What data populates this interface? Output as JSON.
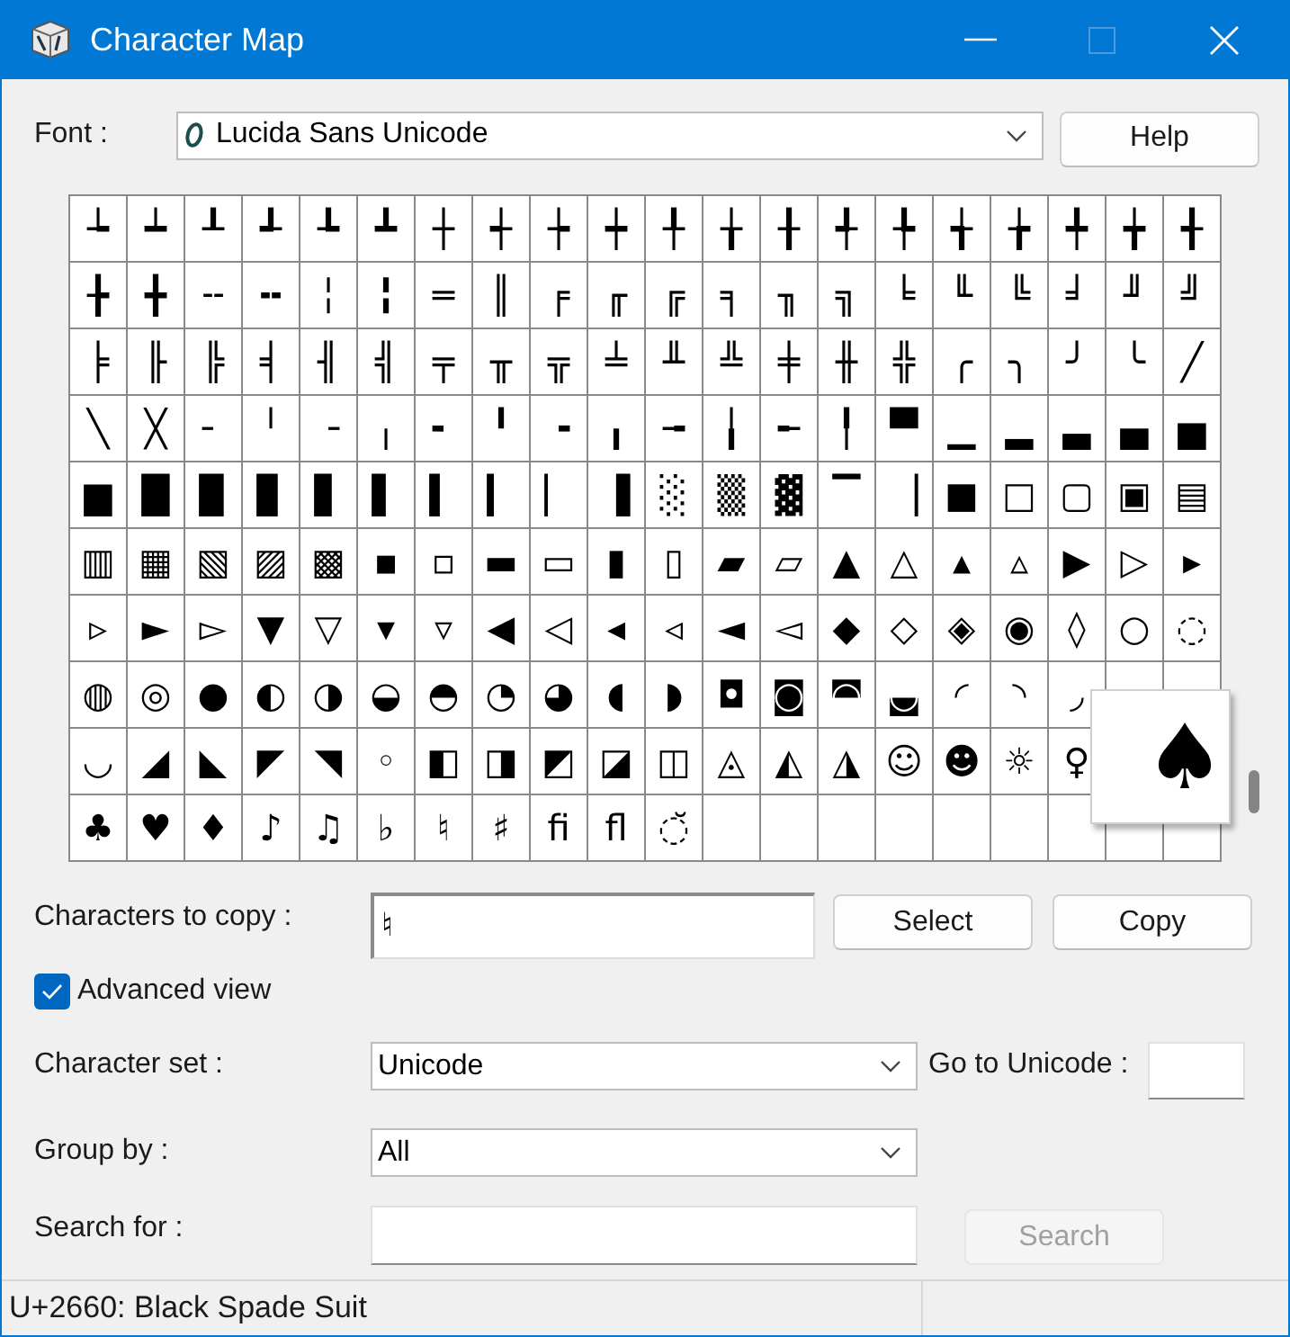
{
  "window": {
    "title": "Character Map"
  },
  "font": {
    "label": "Font :",
    "value": "Lucida Sans Unicode"
  },
  "help_button": {
    "label": "Help"
  },
  "grid": {
    "rows": [
      [
        "┶",
        "┷",
        "┸",
        "┹",
        "┺",
        "┻",
        "┼",
        "┽",
        "┾",
        "┿",
        "╀",
        "╁",
        "╂",
        "╃",
        "╄",
        "╅",
        "╆",
        "╇",
        "╈",
        "╉"
      ],
      [
        "╊",
        "╋",
        "╌",
        "╍",
        "╎",
        "╏",
        "═",
        "║",
        "╒",
        "╓",
        "╔",
        "╕",
        "╖",
        "╗",
        "╘",
        "╙",
        "╚",
        "╛",
        "╜",
        "╝"
      ],
      [
        "╞",
        "╟",
        "╠",
        "╡",
        "╢",
        "╣",
        "╤",
        "╥",
        "╦",
        "╧",
        "╨",
        "╩",
        "╪",
        "╫",
        "╬",
        "╭",
        "╮",
        "╯",
        "╰",
        "╱"
      ],
      [
        "╲",
        "╳",
        "╴",
        "╵",
        "╶",
        "╷",
        "╸",
        "╹",
        "╺",
        "╻",
        "╼",
        "╽",
        "╾",
        "╿",
        "▀",
        "▁",
        "▂",
        "▃",
        "▄",
        "▅"
      ],
      [
        "▆",
        "█",
        "▉",
        "▊",
        "▋",
        "▌",
        "▍",
        "▎",
        "▏",
        "▐",
        "░",
        "▒",
        "▓",
        "▔",
        "▕",
        "■",
        "□",
        "▢",
        "▣",
        "▤"
      ],
      [
        "▥",
        "▦",
        "▧",
        "▨",
        "▩",
        "▪",
        "▫",
        "▬",
        "▭",
        "▮",
        "▯",
        "▰",
        "▱",
        "▲",
        "△",
        "▴",
        "▵",
        "▶",
        "▷",
        "▸"
      ],
      [
        "▹",
        "►",
        "▻",
        "▼",
        "▽",
        "▾",
        "▿",
        "◀",
        "◁",
        "◂",
        "◃",
        "◄",
        "◅",
        "◆",
        "◇",
        "◈",
        "◉",
        "◊",
        "○",
        "◌"
      ],
      [
        "◍",
        "◎",
        "●",
        "◐",
        "◑",
        "◒",
        "◓",
        "◔",
        "◕",
        "◖",
        "◗",
        "◘",
        "◙",
        "◚",
        "◛",
        "◜",
        "◝",
        "◞"
      ],
      [
        "◡",
        "◢",
        "◣",
        "◤",
        "◥",
        "◦",
        "◧",
        "◨",
        "◩",
        "◪",
        "◫",
        "◬",
        "◭",
        "◮",
        "☺",
        "☻",
        "☼",
        "♀"
      ],
      [
        "♣",
        "♥",
        "♦",
        "♪",
        "♫",
        "♭",
        "♮",
        "♯",
        "ﬁ",
        "ﬂ",
        "◌̆"
      ]
    ],
    "magnified": "♠"
  },
  "characters_to_copy": {
    "label": "Characters to copy :",
    "value": "♮"
  },
  "select_button": {
    "label": "Select"
  },
  "copy_button": {
    "label": "Copy"
  },
  "advanced_view": {
    "label": "Advanced view",
    "checked": true
  },
  "character_set": {
    "label": "Character set :",
    "value": "Unicode"
  },
  "go_to_unicode": {
    "label": "Go to Unicode :"
  },
  "group_by": {
    "label": "Group by :",
    "value": "All"
  },
  "search_for": {
    "label": "Search for :"
  },
  "search_button": {
    "label": "Search",
    "disabled": true
  },
  "status_bar": {
    "text": "U+2660: Black Spade Suit"
  }
}
